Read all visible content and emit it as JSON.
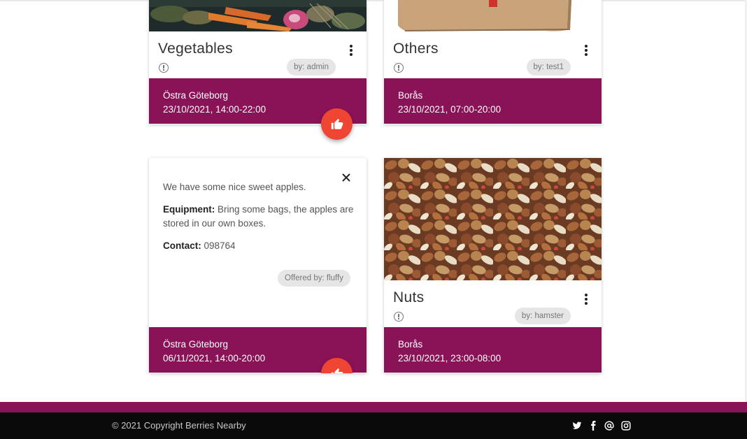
{
  "cards": [
    {
      "title": "Vegetables",
      "author": "by: admin",
      "location": "Östra Göteborg",
      "datetime": "23/10/2021, 14:00-22:00",
      "image": "vegetables-photo"
    },
    {
      "title": "Others",
      "author": "by: test1",
      "location": "Borås",
      "datetime": "23/10/2021, 07:00-20:00",
      "image": "cardboard-box-photo"
    },
    {
      "description": "We have some nice sweet apples.",
      "equipment_label": "Equipment:",
      "equipment_text": "Bring some bags, the apples are stored in our own boxes.",
      "contact_label": "Contact:",
      "contact_value": "098764",
      "offered_by": "Offered by: fluffy",
      "location": "Östra Göteborg",
      "datetime": "06/11/2021, 14:00-20:00"
    },
    {
      "title": "Nuts",
      "author": "by: hamster",
      "location": "Borås",
      "datetime": "23/10/2021, 23:00-08:00",
      "image": "nuts-photo"
    }
  ],
  "footer": {
    "copyright": "© 2021 Copyright Berries Nearby",
    "social": [
      "twitter-icon",
      "facebook-icon",
      "at-icon",
      "instagram-icon"
    ]
  },
  "colors": {
    "brand": "#8a1257",
    "fab": "#ef4634",
    "footer": "#0a0a0a"
  }
}
